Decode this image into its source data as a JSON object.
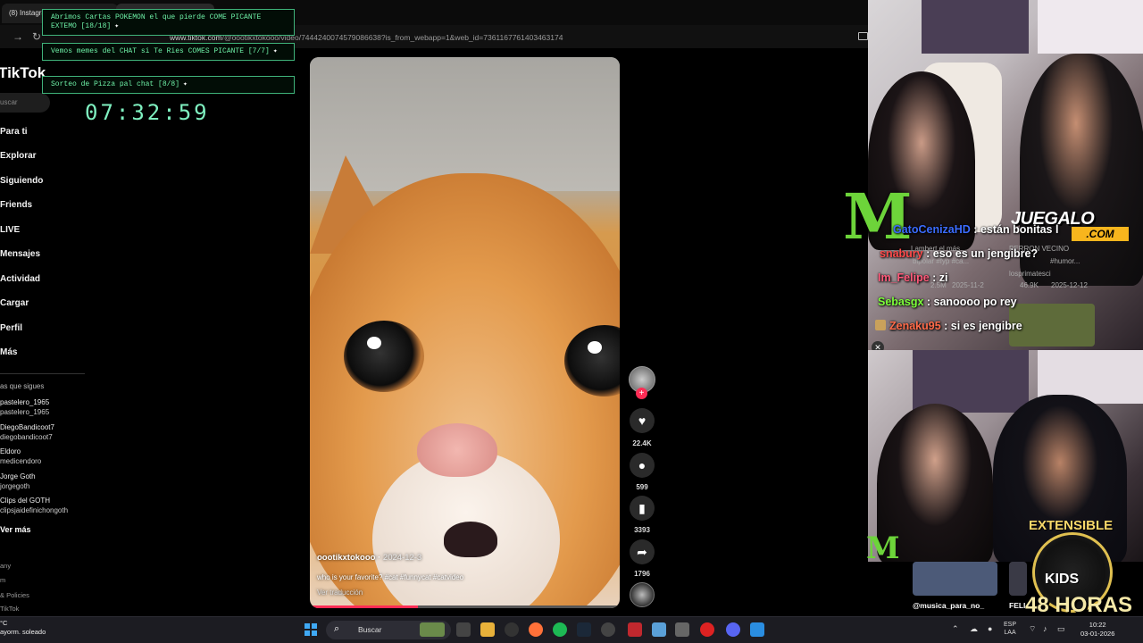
{
  "browser": {
    "tab_title": "(8) Instagram",
    "url_prefix": "www.tiktok.com",
    "url": "/@oootikxtokooo/video/7444240074579086638?is_from_webapp=1&web_id=7361167761403463174"
  },
  "tiktok": {
    "logo": "TikTok",
    "search_placeholder": "uscar",
    "nav": [
      "Para ti",
      "Explorar",
      "Siguiendo",
      "Friends",
      "LIVE",
      "Mensajes",
      "Actividad",
      "Cargar",
      "Perfil",
      "Más"
    ],
    "following_title": "as que sigues",
    "following": [
      {
        "name": "pastelero_1965",
        "handle": "pastelero_1965"
      },
      {
        "name": "DiegoBandicoot7",
        "handle": "diegobandicoot7"
      },
      {
        "name": "Eldoro",
        "handle": "medicendoro"
      },
      {
        "name": "Jorge Goth",
        "handle": "jorgegoth"
      },
      {
        "name": "Clips del GOTH",
        "handle": "clipsjaidefinichongoth"
      }
    ],
    "see_more": "Ver más",
    "footer": [
      "any",
      "m",
      "& Policies",
      "TikTok"
    ]
  },
  "goals": [
    {
      "text": "Abrimos Cartas POKEMON el que pierde COME PICANTE EXTEMO [18/18]",
      "sparkle": "✦"
    },
    {
      "text": "Vemos memes del CHAT si Te Ries COMES PICANTE [7/7]",
      "sparkle": "✦"
    },
    {
      "text": "Sorteo de Pizza pal chat [8/8]",
      "sparkle": "✦"
    }
  ],
  "timer": "07:32:59",
  "video": {
    "author": "oootikxtokooo",
    "date": "2024-12-3",
    "description": "who is your favorite? #cat #funnycat #catvideo",
    "translate": "Ver traducción",
    "progress": 0.35
  },
  "actions": {
    "likes": "22.4K",
    "comments": "599",
    "saves": "3393",
    "shares": "1796"
  },
  "grid_behind": {
    "items": [
      {
        "title": "Lambert el más...",
        "tags": "bipolar #fyp #ca...",
        "views": "2.5M",
        "date": "2025-11-2"
      },
      {
        "title": "PERRON VECINO",
        "tags": "#humor...",
        "user": "losprimatesci",
        "views": "46.9K",
        "date": "2025-12-12"
      }
    ],
    "bottom_users": [
      "@musica_para_no_",
      "FELI"
    ]
  },
  "chat": [
    {
      "user": "GatoCenizaHD",
      "message": "están bonitas l",
      "color": "#3b6cff"
    },
    {
      "user": "snabury",
      "message": "eso es un jengibre?",
      "color": "#ff4b4b"
    },
    {
      "user": "Im_Felipe",
      "message": "zi",
      "color": "#ff5a7a"
    },
    {
      "user": "Sebasgx",
      "message": "sanoooo po rey",
      "color": "#7dff3a"
    },
    {
      "user": "Zenaku95",
      "message": "si es jengibre",
      "color": "#ff6b4a"
    }
  ],
  "sponsors": {
    "juegalo": "JUEGALO",
    "juegalo_com": ".COM"
  },
  "event_badge": {
    "top": "EXTENSIBLE",
    "middle": "KIDS",
    "bottom": "48 HORAS"
  },
  "taskbar": {
    "weather_temp": "°C",
    "weather_desc": "ayorm. soleado",
    "search": "Buscar",
    "lang_top": "ESP",
    "lang_bottom": "LAA",
    "time": "10:22",
    "date": "03-01-2026"
  }
}
